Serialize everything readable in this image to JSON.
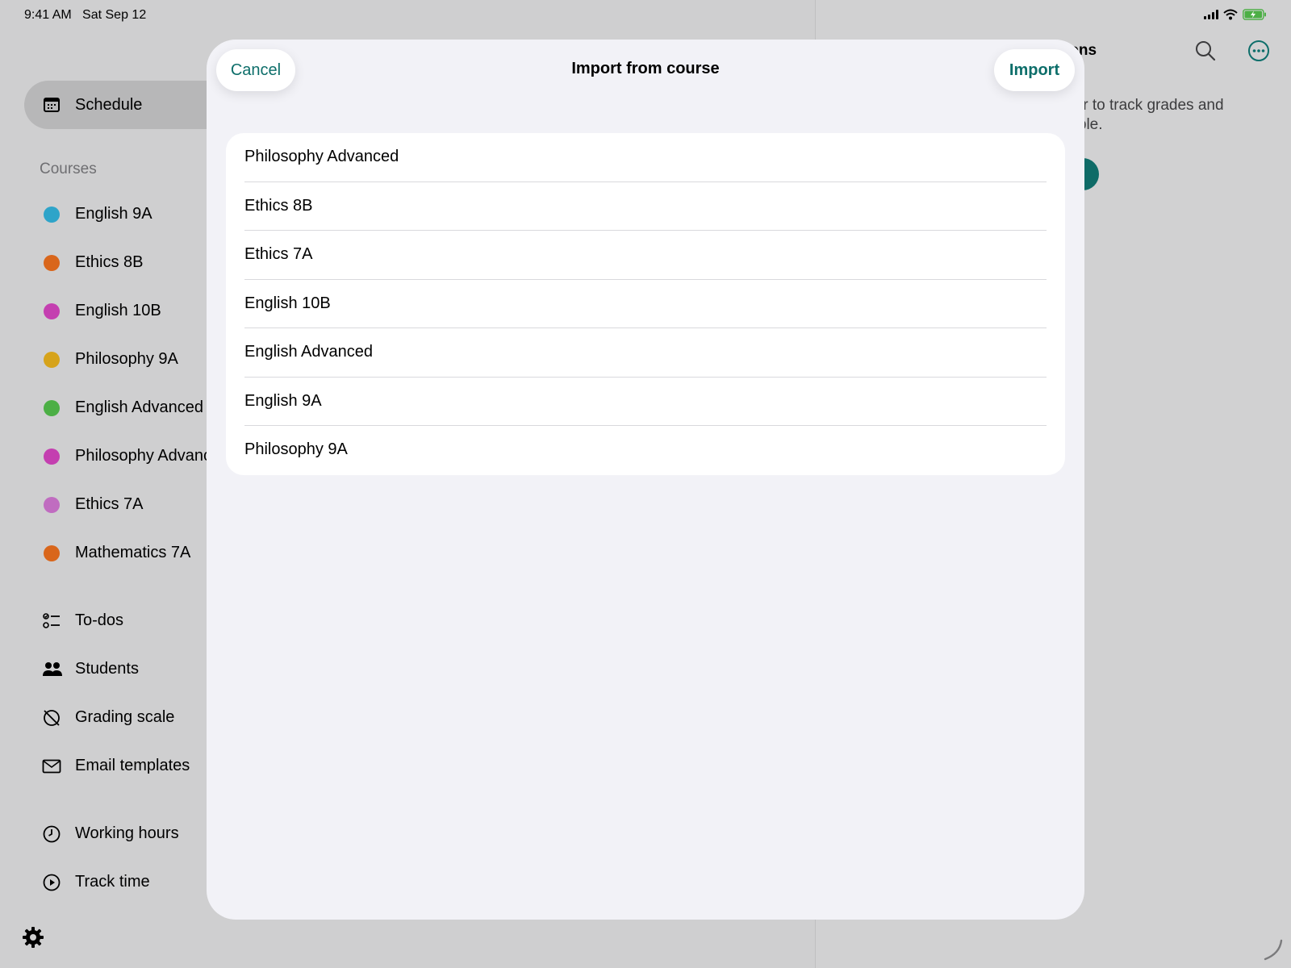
{
  "status_bar": {
    "time": "9:41 AM",
    "date": "Sat Sep 12",
    "icons": [
      "cellular-signal-icon",
      "wifi-icon",
      "battery-charging-icon"
    ]
  },
  "sidebar": {
    "schedule_label": "Schedule",
    "courses_title": "Courses",
    "courses": [
      {
        "label": "English 9A",
        "color": "#2ea4c9"
      },
      {
        "label": "Ethics 8B",
        "color": "#d9661b"
      },
      {
        "label": "English 10B",
        "color": "#c43fb0"
      },
      {
        "label": "Philosophy 9A",
        "color": "#d6a31b"
      },
      {
        "label": "English Advanced",
        "color": "#4caf45"
      },
      {
        "label": "Philosophy Advanc",
        "color": "#c43fb0"
      },
      {
        "label": "Ethics 7A",
        "color": "#c06cc0"
      },
      {
        "label": "Mathematics 7A",
        "color": "#d9661b"
      }
    ],
    "nav": [
      {
        "label": "To-dos",
        "icon": "checklist-icon"
      },
      {
        "label": "Students",
        "icon": "people-icon"
      },
      {
        "label": "Grading scale",
        "icon": "grading-scale-icon"
      },
      {
        "label": "Email templates",
        "icon": "envelope-icon"
      },
      {
        "label": "Working hours",
        "icon": "clock-icon"
      },
      {
        "label": "Track time",
        "icon": "play-circle-icon"
      }
    ]
  },
  "detail": {
    "title_fragment": "ions",
    "text_line1": "endar to track grades and",
    "text_line2": "xample."
  },
  "modal": {
    "title": "Import from course",
    "cancel_label": "Cancel",
    "import_label": "Import",
    "courses": [
      "Philosophy Advanced",
      "Ethics 8B",
      "Ethics 7A",
      "English 10B",
      "English Advanced",
      "English 9A",
      "Philosophy 9A"
    ]
  },
  "colors": {
    "accent": "#0d6e6a",
    "modal_bg": "#f2f2f7",
    "card_bg": "#ffffff"
  }
}
